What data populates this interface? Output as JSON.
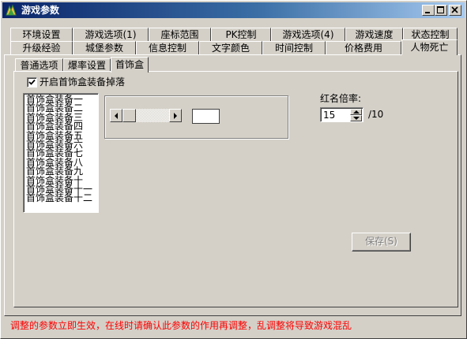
{
  "window": {
    "title": "游戏参数",
    "icon": "app-icon",
    "controls": [
      "minimize-icon",
      "maximize-icon",
      "close-icon"
    ]
  },
  "tabs_row1": [
    "环境设置",
    "游戏选项(1)",
    "座标范围",
    "PK控制",
    "游戏选项(4)",
    "游戏速度",
    "状态控制"
  ],
  "tabs_row2": [
    "升级经验",
    "城堡参数",
    "信息控制",
    "文字颜色",
    "时间控制",
    "价格费用",
    "人物死亡"
  ],
  "tabs_row2_selected": "人物死亡",
  "subtabs": [
    "普通选项",
    "爆率设置",
    "首饰盒"
  ],
  "subtabs_selected": "首饰盒",
  "checkbox": {
    "label": "开启首饰盒装备掉落",
    "checked": true
  },
  "listbox": {
    "items": [
      "首饰盒装备一",
      "首饰盒装备二",
      "首饰盒装备三",
      "首饰盒装备四",
      "首饰盒装备五",
      "首饰盒装备六",
      "首饰盒装备七",
      "首饰盒装备八",
      "首饰盒装备九",
      "首饰盒装备十",
      "首饰盒装备十一",
      "首饰盒装备十二"
    ]
  },
  "scrollbar": {
    "position": 0
  },
  "multiplier": {
    "label": "红名倍率:",
    "value": "15",
    "suffix": "/10"
  },
  "save_button": {
    "label": "保存(S)",
    "enabled": false
  },
  "warning": "调整的参数立即生效，在线时请确认此参数的作用再调整，乱调整将导致游戏混乱",
  "colors": {
    "warning": "#ff0000",
    "title_start": "#0a246a",
    "title_end": "#a6caf0",
    "face": "#d4d0c8"
  }
}
